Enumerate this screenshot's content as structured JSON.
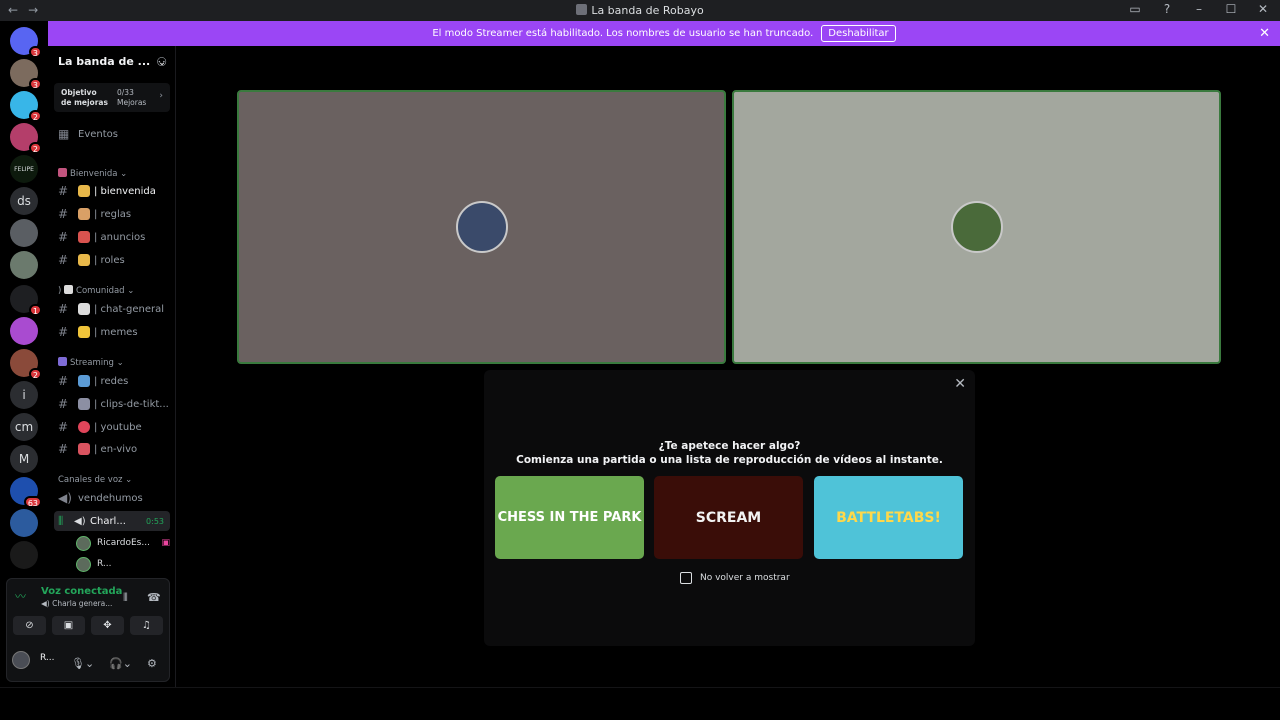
{
  "window": {
    "title": "La banda de Robayo",
    "nav_back": "←",
    "nav_forward": "→"
  },
  "banner": {
    "message": "El modo Streamer está habilitado. Los nombres de usuario se han truncado.",
    "button": "Deshabilitar",
    "close": "✕"
  },
  "guilds": [
    {
      "label": "",
      "badge": "3",
      "color": "#5865f2",
      "icon": "discord-icon"
    },
    {
      "label": "",
      "badge": "3",
      "color": "#7c6b5e",
      "icon": "avatar"
    },
    {
      "label": "",
      "badge": "2",
      "color": "#38b6e8",
      "icon": "avatar"
    },
    {
      "label": "",
      "badge": "2",
      "color": "#b43e6a",
      "icon": "avatar"
    },
    {
      "label": "FELIPE",
      "badge": "",
      "color": "#0d1a0d",
      "icon": "logo"
    },
    {
      "label": "ds",
      "badge": "",
      "color": "#2b2d31",
      "icon": ""
    },
    {
      "label": "",
      "badge": "",
      "color": "#5a5e63",
      "icon": "avatar"
    },
    {
      "label": "",
      "badge": "",
      "color": "#6b7a6d",
      "icon": "avatar"
    },
    {
      "label": "",
      "badge": "1",
      "color": "#1e1f22",
      "icon": "logo"
    },
    {
      "label": "",
      "badge": "",
      "color": "#a94bd0",
      "icon": "avatar"
    },
    {
      "label": "",
      "badge": "2",
      "color": "#8a4a3a",
      "icon": "avatar"
    },
    {
      "label": "i",
      "badge": "",
      "color": "#2b2d31",
      "icon": ""
    },
    {
      "label": "cm",
      "badge": "",
      "color": "#2b2d31",
      "icon": ""
    },
    {
      "label": "M",
      "badge": "",
      "color": "#2b2d31",
      "icon": ""
    },
    {
      "label": "",
      "badge": "63",
      "color": "#1e4fae",
      "icon": "avatar"
    },
    {
      "label": "",
      "badge": "",
      "color": "#2c5b9e",
      "icon": "logo"
    },
    {
      "label": "",
      "badge": "",
      "color": "#1a1a1a",
      "icon": "logo"
    }
  ],
  "server": {
    "name": "La banda de ...",
    "boost_title": "Objetivo de mejoras",
    "boost_count": "0/33",
    "boost_unit": "Mejoras",
    "events": "Eventos"
  },
  "categories": {
    "bienvenida": "Bienvenida",
    "comunidad": "Comunidad",
    "streaming": "Streaming",
    "voz": "Canales de voz"
  },
  "channels": {
    "bienvenida": "| bienvenida",
    "reglas": "| reglas",
    "anuncios": "| anuncios",
    "roles": "| roles",
    "chat_general": "| chat-general",
    "memes": "| memes",
    "redes": "| redes",
    "clips": "| clips-de-tikt...",
    "youtube": "| youtube",
    "en_vivo": "| en-vivo",
    "vendehumos": "vendehumos",
    "charla": "Charl...",
    "charla_timer": "0:53"
  },
  "members": [
    "RicardoEs...",
    "R..."
  ],
  "voice_panel": {
    "status": "Voz conectada",
    "channel": "Charla genera...",
    "username": "R..."
  },
  "activity": {
    "question": "¿Te apetece hacer algo?",
    "subtitle": "Comienza una partida o una lista de reproducción de vídeos al instante.",
    "cards": [
      {
        "title": "CHESS IN THE PARK",
        "bg": "#6aa84f",
        "fg": "#ffffff"
      },
      {
        "title": "SCREAM",
        "bg": "#3a0d08",
        "fg": "#f2f2f2"
      },
      {
        "title": "BATTLETABS!",
        "bg": "#4fc3d8",
        "fg": "#ffd84a"
      }
    ],
    "dont_show": "No volver a mostrar",
    "close": "✕"
  },
  "colors": {
    "streamer_banner": "#9b46f5",
    "voice_connected": "#23a55a",
    "tile_left": "#6a6160",
    "tile_right": "#a3a79e",
    "speaking_border": "#3a7a3e"
  }
}
